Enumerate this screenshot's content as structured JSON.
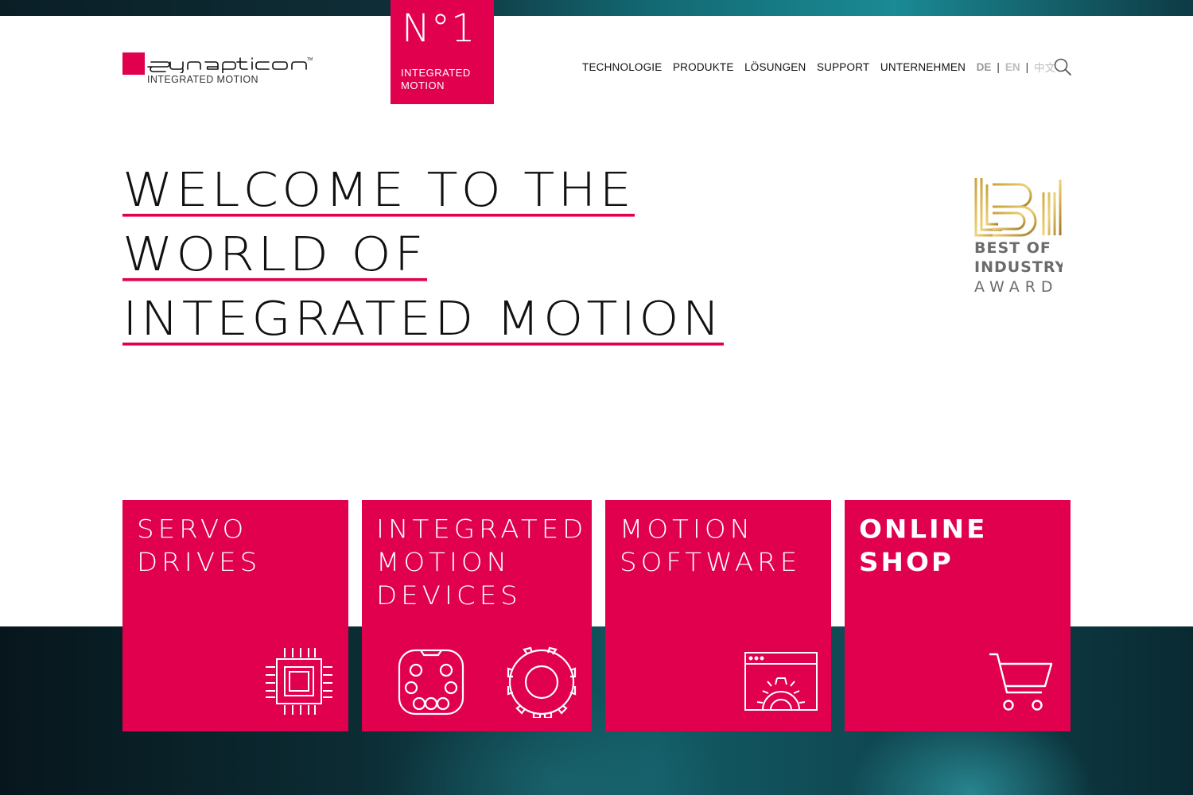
{
  "brand": {
    "name": "synapticon",
    "tagline": "INTEGRATED MOTION",
    "accent": "#e0004d"
  },
  "badge": {
    "big": "N°1",
    "small": "INTEGRATED MOTION"
  },
  "nav": {
    "items": [
      "TECHNOLOGIE",
      "PRODUKTE",
      "LÖSUNGEN",
      "SUPPORT",
      "UNTERNEHMEN"
    ],
    "languages": [
      "DE",
      "EN",
      "中文"
    ],
    "search_icon": "search-icon"
  },
  "hero": {
    "lines": [
      "WELCOME TO THE",
      "WORLD OF",
      "INTEGRATED MOTION"
    ]
  },
  "award": {
    "line1": "BEST OF",
    "line2": "INDUSTRY",
    "line3": "AWARD"
  },
  "tiles": [
    {
      "title": "SERVO\nDRIVES",
      "icon": "chip-icon"
    },
    {
      "title": "INTEGRATED\nMOTION\nDEVICES",
      "icon": "motion-device-icons"
    },
    {
      "title": "MOTION\nSOFTWARE",
      "icon": "software-window-icon"
    },
    {
      "title": "ONLINE\nSHOP",
      "icon": "cart-icon"
    }
  ]
}
